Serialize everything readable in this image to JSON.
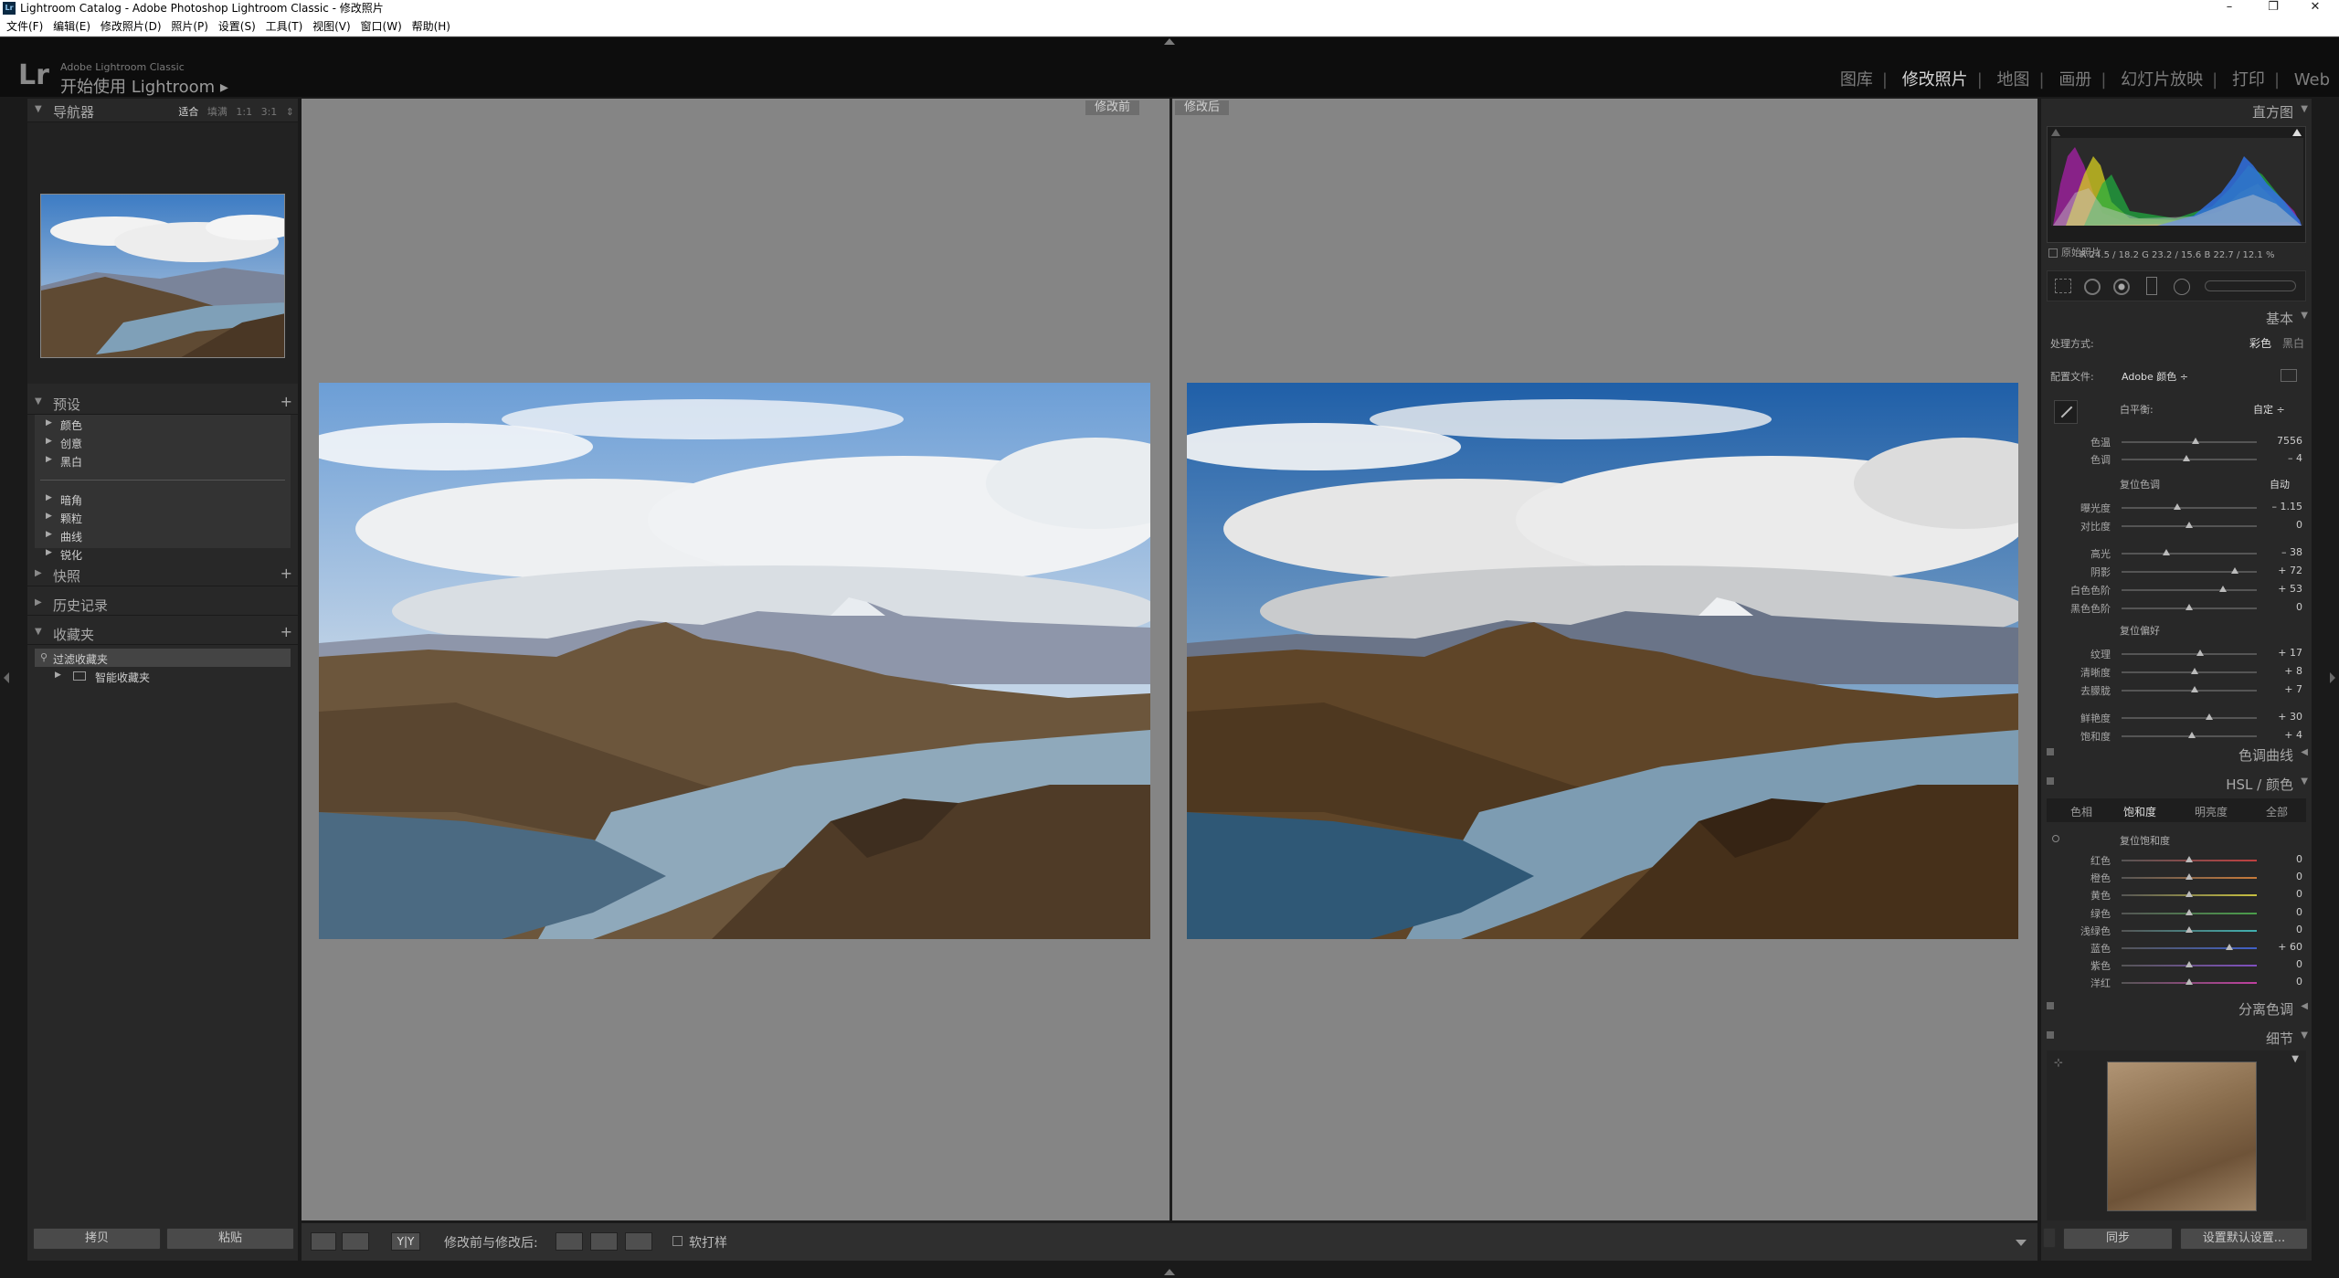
{
  "window": {
    "app_icon": "Lr",
    "title": "Lightroom Catalog - Adobe Photoshop Lightroom Classic - 修改照片",
    "minimize": "–",
    "maximize": "❐",
    "close": "✕"
  },
  "menu": [
    "文件(F)",
    "编辑(E)",
    "修改照片(D)",
    "照片(P)",
    "设置(S)",
    "工具(T)",
    "视图(V)",
    "窗口(W)",
    "帮助(H)"
  ],
  "identity": {
    "logo": "Lr",
    "sub": "Adobe Lightroom Classic",
    "main": "开始使用 Lightroom ▸"
  },
  "modules": [
    {
      "label": "图库",
      "active": false
    },
    {
      "label": "修改照片",
      "active": true
    },
    {
      "label": "地图",
      "active": false
    },
    {
      "label": "画册",
      "active": false
    },
    {
      "label": "幻灯片放映",
      "active": false
    },
    {
      "label": "打印",
      "active": false
    },
    {
      "label": "Web",
      "active": false
    }
  ],
  "navigator": {
    "title": "导航器",
    "zoom": [
      "适合",
      "填满",
      "1:1",
      "3:1"
    ],
    "zoom_active": "适合",
    "zoom_menu": "⇕"
  },
  "presets": {
    "title": "预设",
    "group1": [
      "颜色",
      "创意",
      "黑白"
    ],
    "group2": [
      "暗角",
      "颗粒",
      "曲线",
      "锐化"
    ]
  },
  "snapshots": {
    "title": "快照"
  },
  "history": {
    "title": "历史记录"
  },
  "collections": {
    "title": "收藏夹",
    "items": [
      "过滤收藏夹",
      "智能收藏夹"
    ]
  },
  "left_buttons": {
    "copy": "拷贝",
    "paste": "粘贴"
  },
  "center": {
    "before_label": "修改前",
    "after_label": "修改后"
  },
  "toolbar": {
    "yy": "Y|Y",
    "before_after": "修改前与修改后:",
    "soft_proof": "软打样"
  },
  "right": {
    "histogram_title": "直方图",
    "rgb": "R  24.5 / 18.2   G  23.2 / 15.6   B  22.7 / 12.1  %",
    "original_photo": "原始照片",
    "basic_title": "基本",
    "treatment_label": "处理方式:",
    "treatment_color": "彩色",
    "treatment_bw": "黑白",
    "profile_label": "配置文件:",
    "profile_value": "Adobe 颜色 ÷",
    "wb_label": "白平衡:",
    "wb_value": "自定 ÷",
    "wb_sliders": [
      {
        "label": "色温",
        "value": "7556",
        "pos": 0.55
      },
      {
        "label": "色调",
        "value": "– 4",
        "pos": 0.48
      }
    ],
    "tone_label": "复位色调",
    "tone_auto": "自动",
    "tone_sliders": [
      {
        "label": "曝光度",
        "value": "– 1.15",
        "pos": 0.41
      },
      {
        "label": "对比度",
        "value": "0",
        "pos": 0.5
      },
      {
        "label": "高光",
        "value": "– 38",
        "pos": 0.33
      },
      {
        "label": "阴影",
        "value": "+ 72",
        "pos": 0.84
      },
      {
        "label": "白色色阶",
        "value": "+ 53",
        "pos": 0.75
      },
      {
        "label": "黑色色阶",
        "value": "0",
        "pos": 0.5
      }
    ],
    "presence_label": "复位偏好",
    "presence_sliders": [
      {
        "label": "纹理",
        "value": "+ 17",
        "pos": 0.58
      },
      {
        "label": "清晰度",
        "value": "+ 8",
        "pos": 0.54
      },
      {
        "label": "去朦胧",
        "value": "+ 7",
        "pos": 0.54
      },
      {
        "label": "鲜艳度",
        "value": "+ 30",
        "pos": 0.65
      },
      {
        "label": "饱和度",
        "value": "+ 4",
        "pos": 0.52
      }
    ],
    "tone_curve_title": "色调曲线",
    "hsl_title": "HSL / 颜色",
    "hsl_tabs": [
      "色相",
      "饱和度",
      "明亮度",
      "全部"
    ],
    "hsl_active": "饱和度",
    "hsl_reset": "复位饱和度",
    "hsl_sliders": [
      {
        "label": "红色",
        "value": "0",
        "pos": 0.5,
        "color": "#c04040"
      },
      {
        "label": "橙色",
        "value": "0",
        "pos": 0.5,
        "color": "#c87a3a"
      },
      {
        "label": "黄色",
        "value": "0",
        "pos": 0.5,
        "color": "#c8c040"
      },
      {
        "label": "绿色",
        "value": "0",
        "pos": 0.5,
        "color": "#4a9e4a"
      },
      {
        "label": "浅绿色",
        "value": "0",
        "pos": 0.5,
        "color": "#40b0b0"
      },
      {
        "label": "蓝色",
        "value": "+ 60",
        "pos": 0.8,
        "color": "#4060c8"
      },
      {
        "label": "紫色",
        "value": "0",
        "pos": 0.5,
        "color": "#8050c0"
      },
      {
        "label": "洋红",
        "value": "0",
        "pos": 0.5,
        "color": "#c040a0"
      }
    ],
    "split_title": "分离色调",
    "detail_title": "细节",
    "sync": "同步",
    "reset_default": "设置默认设置..."
  }
}
